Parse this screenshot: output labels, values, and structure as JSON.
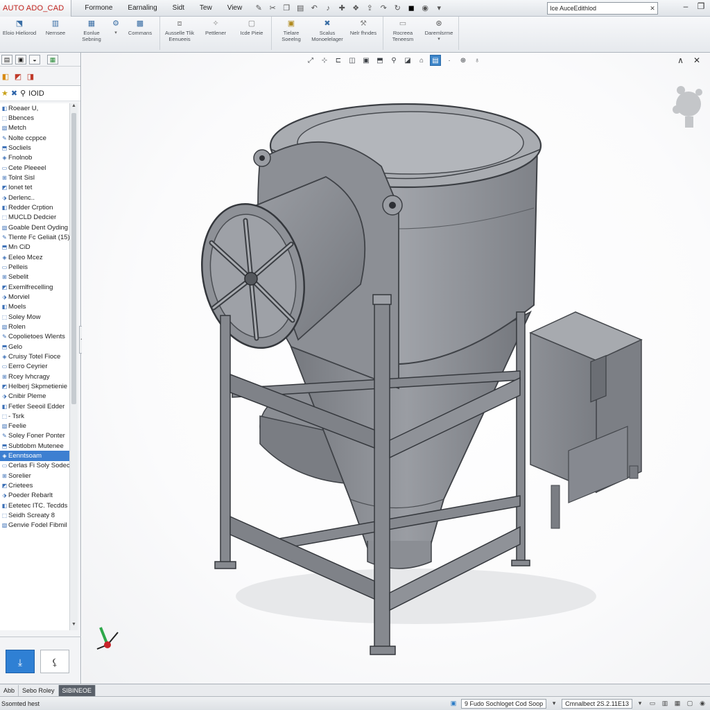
{
  "app": {
    "logo": "AUTO ADO_CAD",
    "menu": [
      "Formone",
      "Earnaling",
      "Sidt",
      "Tew",
      "View"
    ],
    "search_value": "Ice AuceEdithlod"
  },
  "ribbon": {
    "buttons": [
      {
        "label": "Eloio Hieliorod"
      },
      {
        "label": "Nernsee"
      },
      {
        "label": "Eonlue Sebning"
      },
      {
        "label": ""
      },
      {
        "label": "Commans"
      },
      {
        "label": "Ausselle Tlik Eenueeis"
      },
      {
        "label": "Pettlener"
      },
      {
        "label": "Icde Pieie"
      },
      {
        "label": "Tielare Soeelng"
      },
      {
        "label": "Scalus Monoelelager"
      },
      {
        "label": "Nelr fhndes"
      },
      {
        "label": "Rocreea Teneesm"
      },
      {
        "label": "Daremlsrme"
      }
    ]
  },
  "left_panel": {
    "tree_head": "IOID",
    "items": [
      "Roeaer U,",
      "Bbences",
      "Metch",
      "Nolte ccppce",
      "Socliels",
      "Fnolnob",
      "Cete Pleeeel",
      "Tolnt Sisl",
      "Ionet tet",
      "Derlenc..",
      "Redder Crption",
      "MUCLD Dedcier",
      "Goable Dent Oyding",
      "Tlente Fc Geliait (15)",
      "Mn CiD",
      "Eeleo Mcez",
      "Pelleis",
      "Sebelit",
      "Exemlfrecelling",
      "Morviel",
      "Moels",
      "Soley Mow",
      "Rolen",
      "Copolietoes Wlents",
      "Gelo",
      "Cruisy Totel Fioce",
      "Eerro Ceyrier",
      "Rcey lvhcragy",
      "Helberj Skpmetienie",
      "Cnibir Pleme",
      "Fetler Seeoil Edder",
      "- Tsrk",
      "Feelie",
      "Soley Foner Ponter",
      "Subtlobm Mutenee",
      "Eenntsoam",
      "Cerlas Fi Soly Sodec",
      "Sorelier",
      "Crietees",
      "Poeder Rebarlt",
      "Eetetec ITC. Tecdds",
      "Seidh Screaty 8",
      "Genvie Fodel Fibmil"
    ],
    "selected_index": 35
  },
  "tabstrip": [
    "Abb",
    "Sebo Roley",
    "SIBINEOE"
  ],
  "status": {
    "left": "Ssomted hest",
    "doc": "9 Fudo Sochloget Cod Soop",
    "version": "Cmnalbect 2S.2.11E13"
  },
  "colors": {
    "accent": "#3d7fd1",
    "model_gray": "#9a9da3"
  }
}
